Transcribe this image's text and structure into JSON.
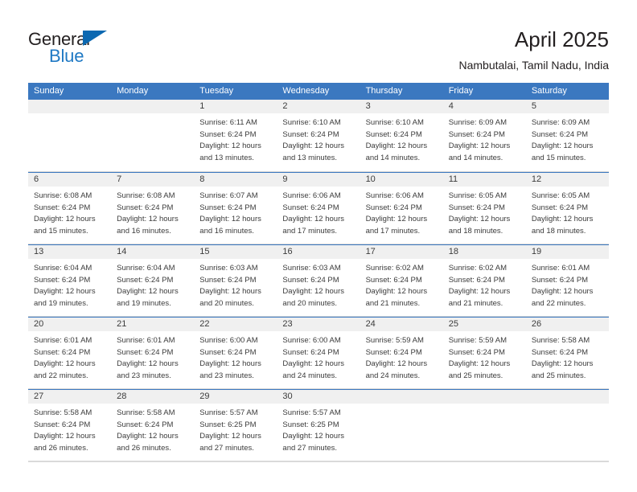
{
  "brand": {
    "word_one": "General",
    "word_two": "Blue",
    "triangle_icon": "triangle-icon",
    "accent_blue": "#1f79c4",
    "dark": "#231f20"
  },
  "header": {
    "title": "April 2025",
    "subtitle": "Nambutalai, Tamil Nadu, India"
  },
  "theme": {
    "header_blue": "#3b78c0",
    "daynum_band": "#f0f0f0",
    "text": "#3b3b3b",
    "cell_border": "#d8d8d8"
  },
  "calendar": {
    "weekdays": [
      "Sunday",
      "Monday",
      "Tuesday",
      "Wednesday",
      "Thursday",
      "Friday",
      "Saturday"
    ],
    "weeks": [
      [
        {
          "day": "",
          "lines": []
        },
        {
          "day": "",
          "lines": []
        },
        {
          "day": "1",
          "lines": [
            "Sunrise: 6:11 AM",
            "Sunset: 6:24 PM",
            "Daylight: 12 hours",
            "and 13 minutes."
          ]
        },
        {
          "day": "2",
          "lines": [
            "Sunrise: 6:10 AM",
            "Sunset: 6:24 PM",
            "Daylight: 12 hours",
            "and 13 minutes."
          ]
        },
        {
          "day": "3",
          "lines": [
            "Sunrise: 6:10 AM",
            "Sunset: 6:24 PM",
            "Daylight: 12 hours",
            "and 14 minutes."
          ]
        },
        {
          "day": "4",
          "lines": [
            "Sunrise: 6:09 AM",
            "Sunset: 6:24 PM",
            "Daylight: 12 hours",
            "and 14 minutes."
          ]
        },
        {
          "day": "5",
          "lines": [
            "Sunrise: 6:09 AM",
            "Sunset: 6:24 PM",
            "Daylight: 12 hours",
            "and 15 minutes."
          ]
        }
      ],
      [
        {
          "day": "6",
          "lines": [
            "Sunrise: 6:08 AM",
            "Sunset: 6:24 PM",
            "Daylight: 12 hours",
            "and 15 minutes."
          ]
        },
        {
          "day": "7",
          "lines": [
            "Sunrise: 6:08 AM",
            "Sunset: 6:24 PM",
            "Daylight: 12 hours",
            "and 16 minutes."
          ]
        },
        {
          "day": "8",
          "lines": [
            "Sunrise: 6:07 AM",
            "Sunset: 6:24 PM",
            "Daylight: 12 hours",
            "and 16 minutes."
          ]
        },
        {
          "day": "9",
          "lines": [
            "Sunrise: 6:06 AM",
            "Sunset: 6:24 PM",
            "Daylight: 12 hours",
            "and 17 minutes."
          ]
        },
        {
          "day": "10",
          "lines": [
            "Sunrise: 6:06 AM",
            "Sunset: 6:24 PM",
            "Daylight: 12 hours",
            "and 17 minutes."
          ]
        },
        {
          "day": "11",
          "lines": [
            "Sunrise: 6:05 AM",
            "Sunset: 6:24 PM",
            "Daylight: 12 hours",
            "and 18 minutes."
          ]
        },
        {
          "day": "12",
          "lines": [
            "Sunrise: 6:05 AM",
            "Sunset: 6:24 PM",
            "Daylight: 12 hours",
            "and 18 minutes."
          ]
        }
      ],
      [
        {
          "day": "13",
          "lines": [
            "Sunrise: 6:04 AM",
            "Sunset: 6:24 PM",
            "Daylight: 12 hours",
            "and 19 minutes."
          ]
        },
        {
          "day": "14",
          "lines": [
            "Sunrise: 6:04 AM",
            "Sunset: 6:24 PM",
            "Daylight: 12 hours",
            "and 19 minutes."
          ]
        },
        {
          "day": "15",
          "lines": [
            "Sunrise: 6:03 AM",
            "Sunset: 6:24 PM",
            "Daylight: 12 hours",
            "and 20 minutes."
          ]
        },
        {
          "day": "16",
          "lines": [
            "Sunrise: 6:03 AM",
            "Sunset: 6:24 PM",
            "Daylight: 12 hours",
            "and 20 minutes."
          ]
        },
        {
          "day": "17",
          "lines": [
            "Sunrise: 6:02 AM",
            "Sunset: 6:24 PM",
            "Daylight: 12 hours",
            "and 21 minutes."
          ]
        },
        {
          "day": "18",
          "lines": [
            "Sunrise: 6:02 AM",
            "Sunset: 6:24 PM",
            "Daylight: 12 hours",
            "and 21 minutes."
          ]
        },
        {
          "day": "19",
          "lines": [
            "Sunrise: 6:01 AM",
            "Sunset: 6:24 PM",
            "Daylight: 12 hours",
            "and 22 minutes."
          ]
        }
      ],
      [
        {
          "day": "20",
          "lines": [
            "Sunrise: 6:01 AM",
            "Sunset: 6:24 PM",
            "Daylight: 12 hours",
            "and 22 minutes."
          ]
        },
        {
          "day": "21",
          "lines": [
            "Sunrise: 6:01 AM",
            "Sunset: 6:24 PM",
            "Daylight: 12 hours",
            "and 23 minutes."
          ]
        },
        {
          "day": "22",
          "lines": [
            "Sunrise: 6:00 AM",
            "Sunset: 6:24 PM",
            "Daylight: 12 hours",
            "and 23 minutes."
          ]
        },
        {
          "day": "23",
          "lines": [
            "Sunrise: 6:00 AM",
            "Sunset: 6:24 PM",
            "Daylight: 12 hours",
            "and 24 minutes."
          ]
        },
        {
          "day": "24",
          "lines": [
            "Sunrise: 5:59 AM",
            "Sunset: 6:24 PM",
            "Daylight: 12 hours",
            "and 24 minutes."
          ]
        },
        {
          "day": "25",
          "lines": [
            "Sunrise: 5:59 AM",
            "Sunset: 6:24 PM",
            "Daylight: 12 hours",
            "and 25 minutes."
          ]
        },
        {
          "day": "26",
          "lines": [
            "Sunrise: 5:58 AM",
            "Sunset: 6:24 PM",
            "Daylight: 12 hours",
            "and 25 minutes."
          ]
        }
      ],
      [
        {
          "day": "27",
          "lines": [
            "Sunrise: 5:58 AM",
            "Sunset: 6:24 PM",
            "Daylight: 12 hours",
            "and 26 minutes."
          ]
        },
        {
          "day": "28",
          "lines": [
            "Sunrise: 5:58 AM",
            "Sunset: 6:24 PM",
            "Daylight: 12 hours",
            "and 26 minutes."
          ]
        },
        {
          "day": "29",
          "lines": [
            "Sunrise: 5:57 AM",
            "Sunset: 6:25 PM",
            "Daylight: 12 hours",
            "and 27 minutes."
          ]
        },
        {
          "day": "30",
          "lines": [
            "Sunrise: 5:57 AM",
            "Sunset: 6:25 PM",
            "Daylight: 12 hours",
            "and 27 minutes."
          ]
        },
        {
          "day": "",
          "lines": []
        },
        {
          "day": "",
          "lines": []
        },
        {
          "day": "",
          "lines": []
        }
      ]
    ]
  }
}
